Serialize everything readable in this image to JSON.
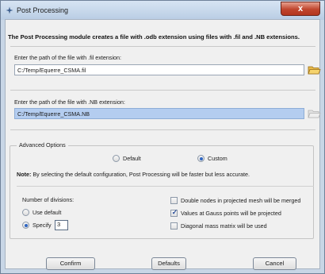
{
  "window": {
    "title": "Post Processing",
    "close_glyph": "x"
  },
  "header": "The Post Processing module creates a file with .odb extension using files with .fil and .NB extensions.",
  "fil_section": {
    "label": "Enter the path of the file with .fil extension:",
    "value": "C:/Temp/Equerre_CSMA.fil",
    "browse_icon": "folder-open-icon"
  },
  "nb_section": {
    "label": "Enter the path of the file with .NB extension:",
    "value": "C:/Temp/Equerre_CSMA.NB",
    "browse_icon": "folder-open-icon-disabled"
  },
  "advanced": {
    "legend": "Advanced Options",
    "mode_options": [
      {
        "label": "Default",
        "checked": false
      },
      {
        "label": "Custom",
        "checked": true
      }
    ],
    "note_prefix": "Note:",
    "note_text": "By selecting the default configuration, Post Processing will be faster but less accurate.",
    "divisions": {
      "label": "Number of divisions:",
      "use_default_label": "Use default",
      "use_default_checked": false,
      "specify_label": "Specify",
      "specify_checked": true,
      "specify_value": "3"
    },
    "checkboxes": [
      {
        "label": "Double nodes in projected mesh will be merged",
        "checked": false
      },
      {
        "label": "Values at Gauss points will be projected",
        "checked": true
      },
      {
        "label": "Diagonal mass matrix will be used",
        "checked": false
      }
    ]
  },
  "buttons": {
    "confirm": "Confirm",
    "defaults": "Defaults",
    "cancel": "Cancel"
  },
  "colors": {
    "selection": "#b4cdf0",
    "close_red": "#c0452e",
    "radio_dot": "#2f66c2"
  }
}
